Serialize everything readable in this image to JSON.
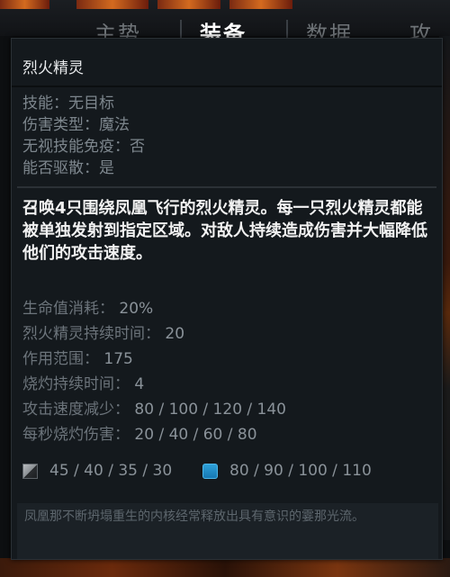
{
  "background": {
    "tabs": [
      "主势",
      "装备",
      "数据",
      "攻略"
    ]
  },
  "tooltip": {
    "title": "烈火精灵",
    "properties": [
      "技能：无目标",
      "伤害类型：魔法",
      "无视技能免疫：否",
      "能否驱散：是"
    ],
    "description": "召唤4只围绕凤凰飞行的烈火精灵。每一只烈火精灵都能被单独发射到指定区域。对敌人持续造成伤害并大幅降低他们的攻击速度。",
    "stats": [
      {
        "label": "生命值消耗：",
        "value": "20%"
      },
      {
        "label": "烈火精灵持续时间：",
        "value": "20"
      },
      {
        "label": "作用范围：",
        "value": "175"
      },
      {
        "label": "烧灼持续时间：",
        "value": "4"
      },
      {
        "label": "攻击速度减少：",
        "value": "80 / 100 / 120 / 140"
      },
      {
        "label": "每秒烧灼伤害：",
        "value": "20 / 40 / 60 / 80"
      }
    ],
    "cooldown": {
      "icon": "cooldown-icon",
      "value": "45 / 40 / 35 / 30"
    },
    "mana": {
      "icon": "mana-icon",
      "value": "80 / 90 / 100 / 110",
      "color": "#1e8fcf"
    },
    "lore": "凤凰那不断坍塌重生的内核经常释放出具有意识的霎那光流。"
  }
}
